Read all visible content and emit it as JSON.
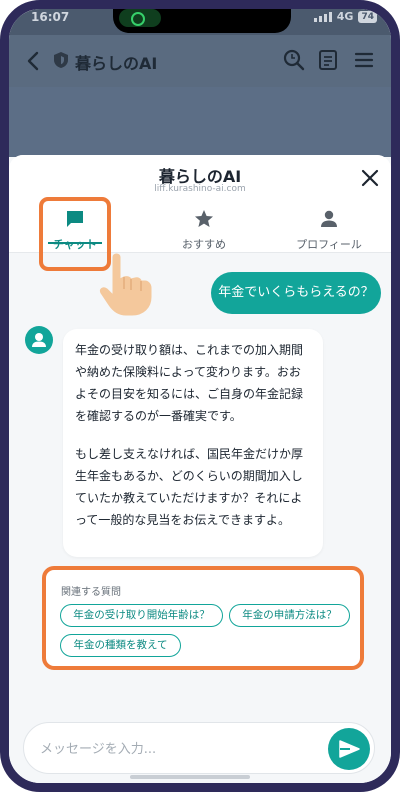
{
  "status": {
    "time": "16:07",
    "network": "4G",
    "battery": "74"
  },
  "appbar": {
    "title": "暮らしのAI"
  },
  "sheet": {
    "title": "暮らしのAI",
    "url": "liff.kurashino-ai.com"
  },
  "tabs": [
    {
      "label": "チャット",
      "icon": "chat-icon",
      "active": true
    },
    {
      "label": "おすすめ",
      "icon": "star-icon",
      "active": false
    },
    {
      "label": "プロフィール",
      "icon": "person-icon",
      "active": false
    }
  ],
  "chat": {
    "user_message": "年金でいくらもらえるの？",
    "bot_paragraph_1": "年金の受け取り額は、これまでの加入期間や納めた保険料によって変わります。おおよその目安を知るには、ご自身の年金記録を確認するのが一番確実です。",
    "bot_paragraph_2": "もし差し支えなければ、国民年金だけか厚生年金もあるか、どのくらいの期間加入していたか教えていただけますか？それによって一般的な見当をお伝えできますよ。"
  },
  "related": {
    "label": "関連する質問",
    "chips": [
      "年金の受け取り開始年齢は？",
      "年金の申請方法は？",
      "年金の種類を教えて"
    ]
  },
  "input": {
    "placeholder": "メッセージを入力..."
  },
  "colors": {
    "accent": "#12a59a",
    "highlight": "#ee7b3a",
    "frame": "#2e2a5a"
  }
}
